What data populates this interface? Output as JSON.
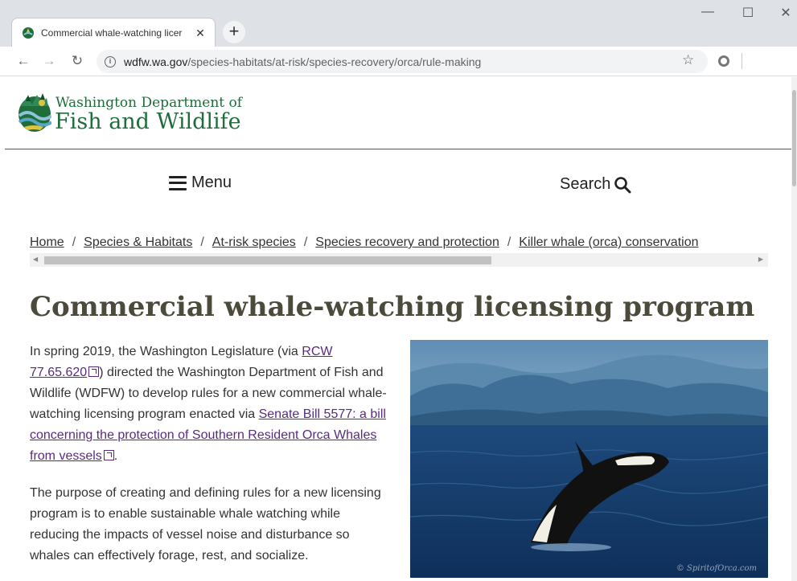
{
  "browser": {
    "tab_title": "Commercial whale-watching licer",
    "tab_close": "✕",
    "new_tab": "+",
    "window_minimize": "—",
    "window_maximize": "☐",
    "window_close": "✕",
    "url_host": "wdfw.wa.gov",
    "url_path": "/species-habitats/at-risk/species-recovery/orca/rule-making",
    "icons": [
      "back-arrow-icon",
      "forward-arrow-icon",
      "reload-icon",
      "info-icon",
      "star-icon",
      "extension-icon"
    ]
  },
  "header": {
    "dept_line1": "Washington Department of",
    "dept_line2": "Fish and Wildlife",
    "brand_color": "#1f6d3b"
  },
  "nav": {
    "menu_label": "Menu",
    "search_label": "Search"
  },
  "breadcrumb": {
    "items": [
      "Home",
      "Species & Habitats",
      "At-risk species",
      "Species recovery and protection",
      "Killer whale (orca) conservation"
    ],
    "separator": "/"
  },
  "main": {
    "title": "Commercial whale-watching licensing program",
    "title_color": "#4b4a3b",
    "intro": {
      "text1": "In spring 2019, the Washington Legislature (via ",
      "link1": "RCW 77.65.620",
      "text2": ") directed the Washington Department of Fish and Wildlife (WDFW) to develop rules for a new commercial whale-watching licensing program enacted via ",
      "link2": "Senate Bill 5577: a bill concerning the protection of Southern Resident Orca Whales from vessels",
      "text3": "."
    },
    "para2": "The purpose of creating and defining rules for a new licensing program is to enable sustainable whale watching while reducing the impacts of vessel noise and disturbance so whales can effectively forage, rest, and socialize.",
    "photo_credit": "© SpiritofOrca.com",
    "link_color": "#5a2a82"
  }
}
